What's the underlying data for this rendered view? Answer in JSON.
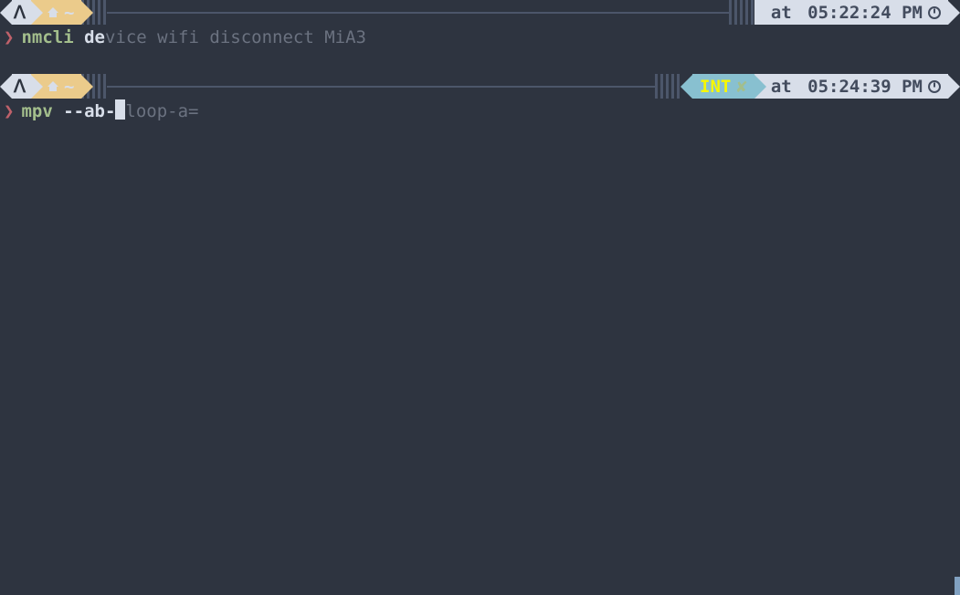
{
  "blocks": [
    {
      "os_glyph": "ᐱ",
      "dir": "~",
      "status": null,
      "time_prefix": "at ",
      "time": "05:22:24 PM",
      "cmd": {
        "prompt": "❯",
        "program": "nmcli",
        "typed": " de",
        "ghost": "vice wifi disconnect MiA3",
        "cursor": false
      }
    },
    {
      "os_glyph": "ᐱ",
      "dir": "~",
      "status": {
        "label": "INT",
        "x": "✘"
      },
      "time_prefix": "at ",
      "time": "05:24:39 PM",
      "cmd": {
        "prompt": "❯",
        "program": "mpv",
        "typed": " --ab-",
        "ghost": "loop-a=",
        "cursor": true
      }
    }
  ]
}
